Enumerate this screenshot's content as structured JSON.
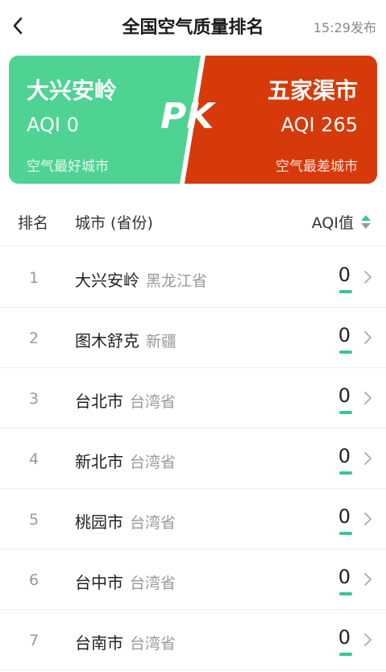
{
  "header": {
    "title": "全国空气质量排名",
    "time": "15:29发布"
  },
  "pk": {
    "best": {
      "city": "大兴安岭",
      "aqi": "AQI 0",
      "label": "空气最好城市",
      "color": "#4fd393"
    },
    "worst": {
      "city": "五家渠市",
      "aqi": "AQI 265",
      "label": "空气最差城市",
      "color": "#d63a0a"
    },
    "mark": "PK"
  },
  "columns": {
    "rank": "排名",
    "city": "城市 (省份)",
    "aqi": "AQI值"
  },
  "rows": [
    {
      "rank": "1",
      "city": "大兴安岭",
      "province": "黑龙江省",
      "aqi": "0"
    },
    {
      "rank": "2",
      "city": "图木舒克",
      "province": "新疆",
      "aqi": "0"
    },
    {
      "rank": "3",
      "city": "台北市",
      "province": "台湾省",
      "aqi": "0"
    },
    {
      "rank": "4",
      "city": "新北市",
      "province": "台湾省",
      "aqi": "0"
    },
    {
      "rank": "5",
      "city": "桃园市",
      "province": "台湾省",
      "aqi": "0"
    },
    {
      "rank": "6",
      "city": "台中市",
      "province": "台湾省",
      "aqi": "0"
    },
    {
      "rank": "7",
      "city": "台南市",
      "province": "台湾省",
      "aqi": "0"
    }
  ],
  "colors": {
    "good": "#3cc58e"
  }
}
